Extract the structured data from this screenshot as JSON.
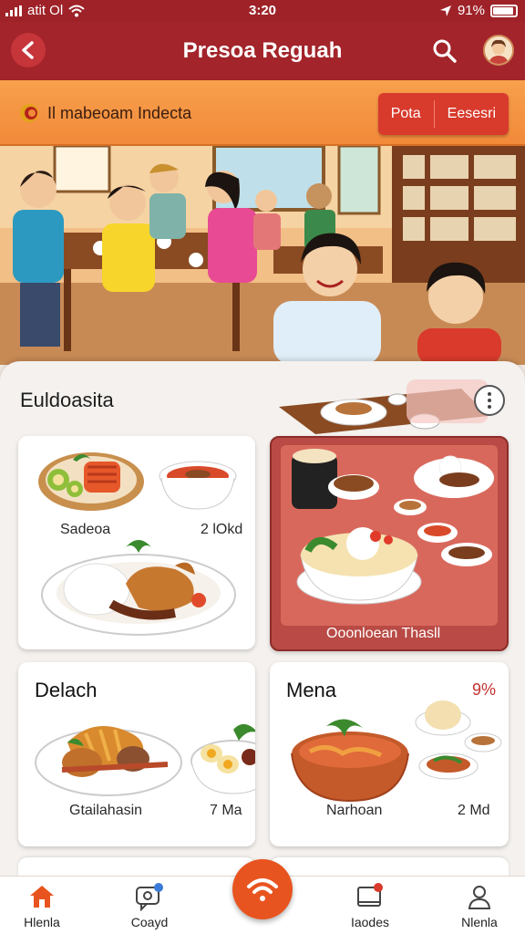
{
  "status_bar": {
    "carrier": "atit Ol",
    "time": "3:20",
    "battery": "91%"
  },
  "header": {
    "title": "Presoa Reguah"
  },
  "banner": {
    "text": "Il mabeoam Indecta",
    "btn_left": "Pota",
    "btn_right": "Eesesri"
  },
  "section": {
    "title": "Euldoasita"
  },
  "cards": [
    {
      "label": "Sadeoa",
      "price": "2 lOkd"
    },
    {
      "label": "Ooonloean Thasll"
    },
    {
      "title": "Delach",
      "label": "Gtailahasin",
      "price": "7 Ma"
    },
    {
      "title": "Mena",
      "badge": "9%",
      "label": "Narhoan",
      "price": "2 Md"
    }
  ],
  "nav": [
    {
      "label": "Hlenla"
    },
    {
      "label": "Coayd"
    },
    {
      "label": "Iaodes"
    },
    {
      "label": "Nlenla"
    }
  ],
  "colors": {
    "brand": "#a3242a",
    "accent": "#e8541f",
    "banner": "#f28a3a"
  }
}
